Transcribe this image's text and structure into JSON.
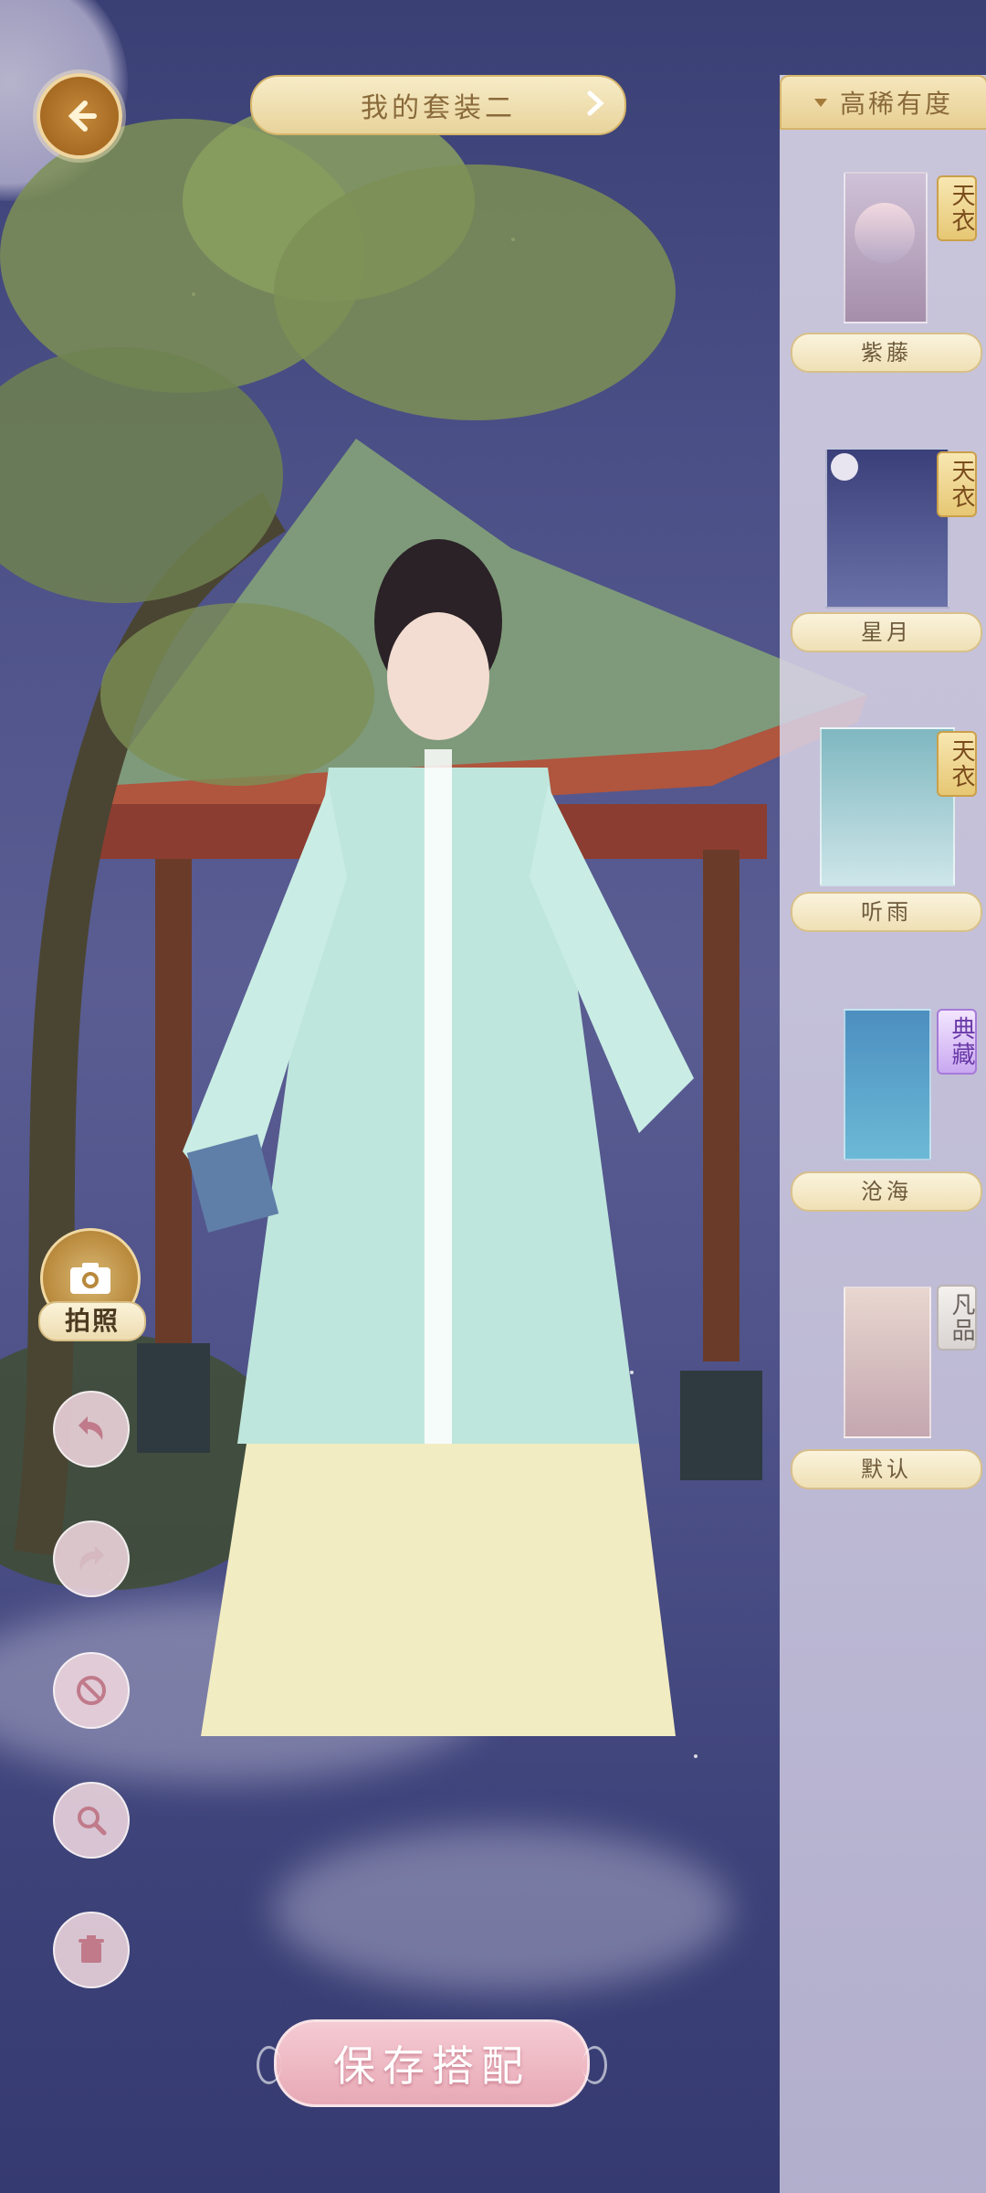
{
  "header": {
    "outfit_title": "我的套装二"
  },
  "panel": {
    "sort_label": "高稀有度",
    "items": [
      {
        "badge": "天衣",
        "label": "紫藤",
        "badge_color": "#e6c774"
      },
      {
        "badge": "天衣",
        "label": "星月",
        "badge_color": "#e6c774"
      },
      {
        "badge": "天衣",
        "label": "听雨",
        "badge_color": "#e6c774"
      },
      {
        "badge": "典藏",
        "label": "沧海",
        "badge_color": "#c9a8f0"
      },
      {
        "badge": "凡品",
        "label": "默认",
        "badge_color": "#d9d4d2"
      }
    ]
  },
  "tools": {
    "photo_label": "拍照"
  },
  "footer": {
    "save_label": "保存搭配"
  },
  "icons": {
    "back": "back-arrow-icon",
    "chevron": "chevron-right-icon",
    "camera": "camera-icon",
    "undo": "undo-icon",
    "redo": "redo-icon",
    "clear": "no-icon",
    "zoom": "magnifier-icon",
    "delete": "trash-icon"
  },
  "colors": {
    "accent_gold": "#e8d39b",
    "save_pink": "#e7a9b6",
    "sky": "#4a4f86"
  }
}
